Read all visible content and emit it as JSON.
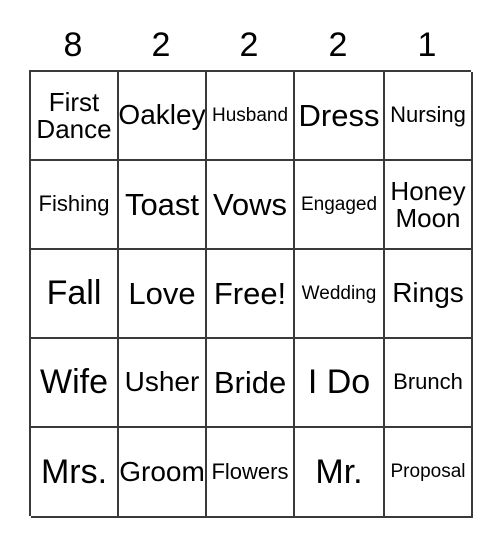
{
  "card": {
    "type": "bingo-card",
    "columns": 5,
    "rows": 5,
    "header_numbers": [
      "8",
      "2",
      "2",
      "2",
      "1"
    ],
    "cells": [
      [
        {
          "text": "First\nDance",
          "size": "wrap"
        },
        {
          "text": "Oakley",
          "size": "md"
        },
        {
          "text": "Husband",
          "size": "xs"
        },
        {
          "text": "Dress",
          "size": "lg"
        },
        {
          "text": "Nursing",
          "size": "sm"
        }
      ],
      [
        {
          "text": "Fishing",
          "size": "sm"
        },
        {
          "text": "Toast",
          "size": "lg"
        },
        {
          "text": "Vows",
          "size": "lg"
        },
        {
          "text": "Engaged",
          "size": "xs"
        },
        {
          "text": "Honey\nMoon",
          "size": "wrap"
        }
      ],
      [
        {
          "text": "Fall",
          "size": "xl"
        },
        {
          "text": "Love",
          "size": "lg"
        },
        {
          "text": "Free!",
          "size": "lg"
        },
        {
          "text": "Wedding",
          "size": "xs"
        },
        {
          "text": "Rings",
          "size": "md"
        }
      ],
      [
        {
          "text": "Wife",
          "size": "xl"
        },
        {
          "text": "Usher",
          "size": "md"
        },
        {
          "text": "Bride",
          "size": "lg"
        },
        {
          "text": "I Do",
          "size": "xl"
        },
        {
          "text": "Brunch",
          "size": "sm"
        }
      ],
      [
        {
          "text": "Mrs.",
          "size": "xl"
        },
        {
          "text": "Groom",
          "size": "md"
        },
        {
          "text": "Flowers",
          "size": "sm"
        },
        {
          "text": "Mr.",
          "size": "xl"
        },
        {
          "text": "Proposal",
          "size": "xs"
        }
      ]
    ],
    "colors": {
      "grid_line": "#3a3a3a",
      "text": "#000000",
      "background": "#ffffff"
    }
  }
}
